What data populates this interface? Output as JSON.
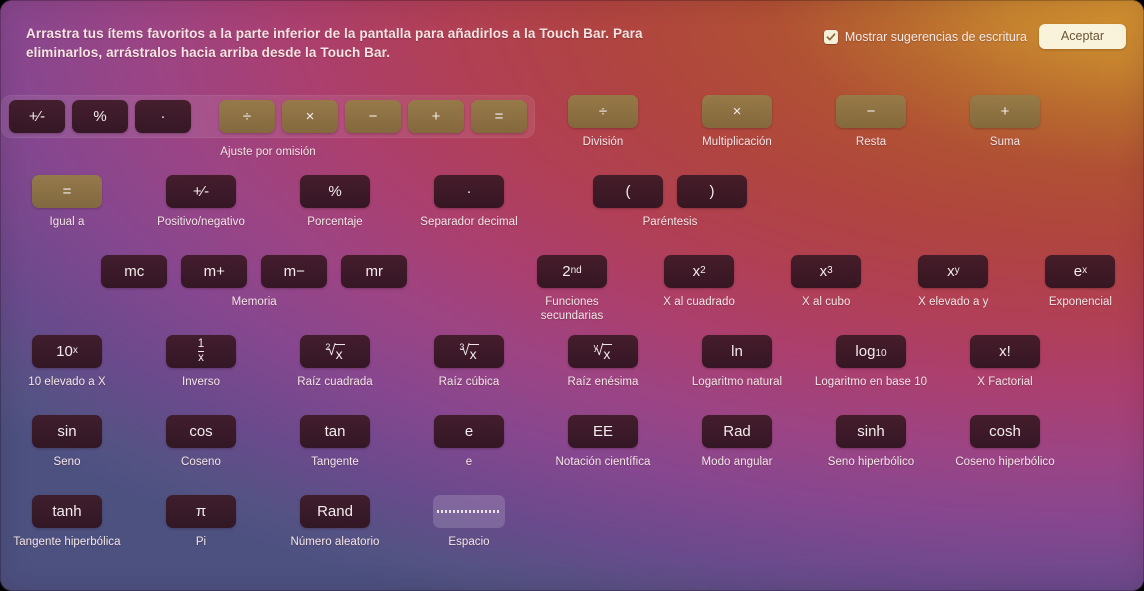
{
  "header": {
    "instructions": "Arrastra tus ítems favoritos a la parte inferior de la pantalla para añadirlos a la Touch Bar. Para eliminarlos, arrástralos hacia arriba desde la Touch Bar.",
    "checkbox_label": "Mostrar sugerencias de escritura",
    "checkbox_checked": true,
    "accept_label": "Aceptar"
  },
  "colors": {
    "accent_gold": "#d2912f",
    "accent_red": "#b04440",
    "accent_magenta": "#ab3f6e",
    "accent_purple": "#6a4a8c",
    "accent_blue": "#4c5180",
    "key_dark": "#3e1a26",
    "key_gold": "#967c48",
    "button_face": "#faf3dc"
  },
  "rows": [
    {
      "cells": [
        {
          "kind": "group",
          "caption": "Ajuste por omisión",
          "keys": [
            {
              "label": "+⁄-",
              "style": "dark",
              "name": "key-plus-minus"
            },
            {
              "label": "%",
              "style": "dark",
              "name": "key-percent"
            },
            {
              "label": "·",
              "style": "dark",
              "name": "key-decimal"
            },
            {
              "label": "GAP",
              "style": "gap",
              "name": "group-gap"
            },
            {
              "label": "÷",
              "style": "gold",
              "name": "key-divide"
            },
            {
              "label": "×",
              "style": "gold",
              "name": "key-multiply"
            },
            {
              "label": "−",
              "style": "gold",
              "name": "key-subtract"
            },
            {
              "label": "+",
              "style": "gold",
              "name": "key-add"
            },
            {
              "label": "=",
              "style": "gold",
              "name": "key-equals"
            }
          ]
        },
        {
          "kind": "item",
          "caption": "División",
          "label": "÷",
          "style": "gold",
          "name": "item-division"
        },
        {
          "kind": "item",
          "caption": "Multiplicación",
          "label": "×",
          "style": "gold",
          "name": "item-multiplicacion"
        },
        {
          "kind": "item",
          "caption": "Resta",
          "label": "−",
          "style": "gold",
          "name": "item-resta"
        },
        {
          "kind": "item",
          "caption": "Suma",
          "label": "+",
          "style": "gold",
          "name": "item-suma"
        }
      ]
    },
    {
      "cells": [
        {
          "kind": "item",
          "caption": "Igual a",
          "label": "=",
          "style": "gold",
          "name": "item-igual-a"
        },
        {
          "kind": "item",
          "caption": "Positivo/negativo",
          "label": "+⁄-",
          "style": "dark",
          "name": "item-positivo-negativo"
        },
        {
          "kind": "item",
          "caption": "Porcentaje",
          "label": "%",
          "style": "dark",
          "name": "item-porcentaje"
        },
        {
          "kind": "item",
          "caption": "Separador decimal",
          "label": "·",
          "style": "dark",
          "name": "item-separador-decimal"
        },
        {
          "kind": "pair",
          "caption": "Paréntesis",
          "keys": [
            {
              "label": "(",
              "style": "dark",
              "name": "key-paren-open"
            },
            {
              "label": ")",
              "style": "dark",
              "name": "key-paren-close"
            }
          ]
        }
      ]
    },
    {
      "cells": [
        {
          "kind": "quad",
          "caption": "Memoria",
          "keys": [
            {
              "label": "mc",
              "style": "dark",
              "name": "key-mc"
            },
            {
              "label": "m+",
              "style": "dark",
              "name": "key-m-plus"
            },
            {
              "label": "m−",
              "style": "dark",
              "name": "key-m-minus"
            },
            {
              "label": "mr",
              "style": "dark",
              "name": "key-mr"
            }
          ]
        },
        {
          "kind": "item",
          "caption": "Funciones\nsecundarias",
          "label": "2nd",
          "style": "dark",
          "name": "item-funciones-secundarias"
        },
        {
          "kind": "item",
          "caption": "X al cuadrado",
          "label": "x2",
          "style": "dark",
          "name": "item-x-al-cuadrado"
        },
        {
          "kind": "item",
          "caption": "X al cubo",
          "label": "x3",
          "style": "dark",
          "name": "item-x-al-cubo"
        },
        {
          "kind": "item",
          "caption": "X elevado a y",
          "label": "xy",
          "style": "dark",
          "name": "item-x-elevado-a-y"
        },
        {
          "kind": "item",
          "caption": "Exponencial",
          "label": "ex",
          "style": "dark",
          "name": "item-exponencial"
        }
      ]
    },
    {
      "cells": [
        {
          "kind": "item",
          "caption": "10 elevado a X",
          "label": "10x",
          "style": "dark",
          "name": "item-10-elevado-a-x"
        },
        {
          "kind": "item",
          "caption": "Inverso",
          "label": "1/x",
          "style": "dark",
          "name": "item-inverso"
        },
        {
          "kind": "item",
          "caption": "Raíz cuadrada",
          "label": "root2",
          "style": "dark",
          "name": "item-raiz-cuadrada"
        },
        {
          "kind": "item",
          "caption": "Raíz cúbica",
          "label": "root3",
          "style": "dark",
          "name": "item-raiz-cubica"
        },
        {
          "kind": "item",
          "caption": "Raíz enésima",
          "label": "rootY",
          "style": "dark",
          "name": "item-raiz-enesima"
        },
        {
          "kind": "item",
          "caption": "Logaritmo natural",
          "label": "ln",
          "style": "dark",
          "name": "item-logaritmo-natural"
        },
        {
          "kind": "item",
          "caption": "Logaritmo en base 10",
          "label": "log10",
          "style": "dark",
          "name": "item-logaritmo-base-10"
        },
        {
          "kind": "item",
          "caption": "X Factorial",
          "label": "x!",
          "style": "dark",
          "name": "item-x-factorial"
        }
      ]
    },
    {
      "cells": [
        {
          "kind": "item",
          "caption": "Seno",
          "label": "sin",
          "style": "dark",
          "name": "item-seno"
        },
        {
          "kind": "item",
          "caption": "Coseno",
          "label": "cos",
          "style": "dark",
          "name": "item-coseno"
        },
        {
          "kind": "item",
          "caption": "Tangente",
          "label": "tan",
          "style": "dark",
          "name": "item-tangente"
        },
        {
          "kind": "item",
          "caption": "e",
          "label": "e",
          "style": "dark",
          "name": "item-e"
        },
        {
          "kind": "item",
          "caption": "Notación científica",
          "label": "EE",
          "style": "dark",
          "name": "item-notacion-cientifica"
        },
        {
          "kind": "item",
          "caption": "Modo angular",
          "label": "Rad",
          "style": "dark",
          "name": "item-modo-angular"
        },
        {
          "kind": "item",
          "caption": "Seno hiperbólico",
          "label": "sinh",
          "style": "dark",
          "name": "item-seno-hiperbolico"
        },
        {
          "kind": "item",
          "caption": "Coseno hiperbólico",
          "label": "cosh",
          "style": "dark",
          "name": "item-coseno-hiperbolico"
        }
      ]
    },
    {
      "cells": [
        {
          "kind": "item",
          "caption": "Tangente hiperbólica",
          "label": "tanh",
          "style": "dark",
          "name": "item-tangente-hiperbolica"
        },
        {
          "kind": "item",
          "caption": "Pi",
          "label": "π",
          "style": "dark",
          "name": "item-pi"
        },
        {
          "kind": "item",
          "caption": "Número aleatorio",
          "label": "Rand",
          "style": "dark",
          "name": "item-numero-aleatorio"
        },
        {
          "kind": "item",
          "caption": "Espacio",
          "label": "dotted",
          "style": "ghost",
          "name": "item-espacio"
        }
      ]
    }
  ]
}
